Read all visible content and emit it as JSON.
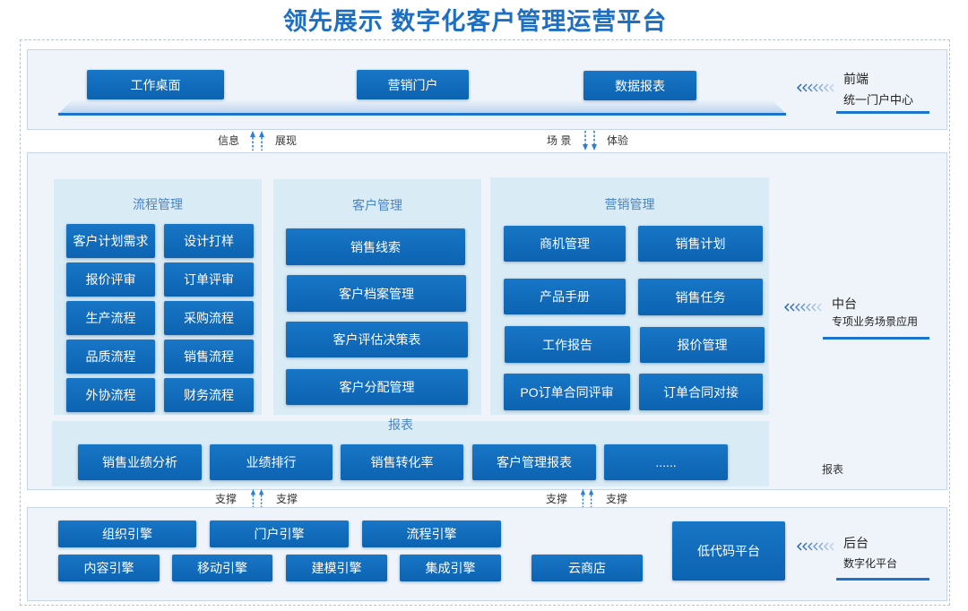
{
  "title": "领先展示 数字化客户管理运营平台",
  "colors": {
    "title": "#1d6fc2",
    "button": "#0e67b5",
    "panel": "#d9ebf4",
    "band": "#eff4fa",
    "accent": "#1c74cc"
  },
  "front": {
    "buttons": [
      "工作桌面",
      "营销门户",
      "数据报表"
    ],
    "layer": {
      "name": "前端",
      "desc": "统一门户中心",
      "icon": "chevrons-left-icon"
    }
  },
  "links_top": [
    {
      "left": "信息",
      "right": "展现",
      "icon": "arrows-up-icon"
    },
    {
      "left": "场 景",
      "right": "体验",
      "icon": "arrows-down-icon"
    }
  ],
  "middle": {
    "process": {
      "title": "流程管理",
      "items": [
        "客户计划需求",
        "设计打样",
        "报价评审",
        "订单评审",
        "生产流程",
        "采购流程",
        "品质流程",
        "销售流程",
        "外协流程",
        "财务流程"
      ]
    },
    "customer": {
      "title": "客户管理",
      "items": [
        "销售线索",
        "客户档案管理",
        "客户评估决策表",
        "客户分配管理"
      ]
    },
    "marketing": {
      "title": "营销管理",
      "items": [
        "商机管理",
        "销售计划",
        "产品手册",
        "销售任务",
        "工作报告",
        "报价管理",
        "PO订单合同评审",
        "订单合同对接"
      ]
    },
    "reports": {
      "title": "报表",
      "items": [
        "销售业绩分析",
        "业绩排行",
        "销售转化率",
        "客户管理报表",
        "......"
      ]
    },
    "layer": {
      "name": "中台",
      "desc": "专项业务场景应用",
      "icon": "chevrons-left-icon"
    },
    "side_label": "报表"
  },
  "links_bottom": [
    {
      "left": "支撑",
      "right": "支撑",
      "icon": "arrows-up-icon"
    },
    {
      "left": "支撑",
      "right": "支撑",
      "icon": "arrows-up-icon"
    }
  ],
  "back": {
    "engines": [
      "组织引擎",
      "门户引擎",
      "流程引擎",
      "内容引擎",
      "移动引擎",
      "建模引擎",
      "集成引擎"
    ],
    "cloud_store": "云商店",
    "low_code": "低代码平台",
    "layer": {
      "name": "后台",
      "desc": "数字化平台",
      "icon": "chevrons-left-icon"
    }
  }
}
